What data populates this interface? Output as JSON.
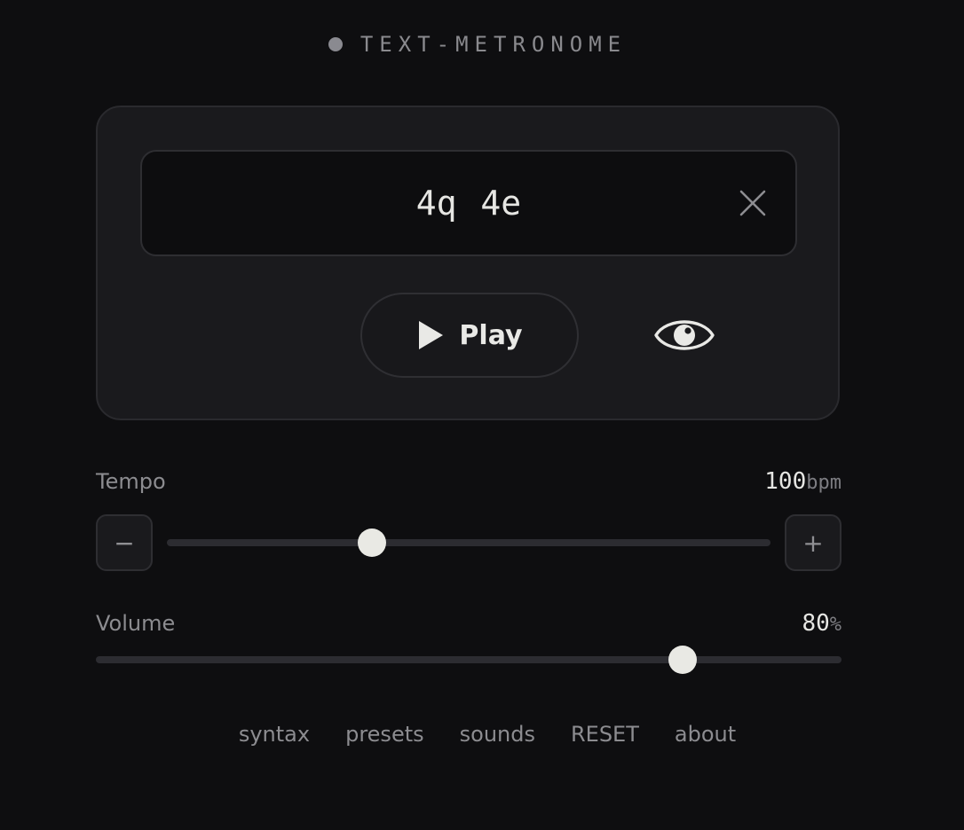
{
  "app": {
    "title": "TEXT-METRONOME"
  },
  "pattern": {
    "value": "4q 4e"
  },
  "controls": {
    "play_label": "Play"
  },
  "tempo": {
    "label": "Tempo",
    "value": "100",
    "unit": "bpm",
    "decrement_label": "−",
    "increment_label": "+",
    "slider_fraction": 0.34
  },
  "volume": {
    "label": "Volume",
    "value": "80",
    "unit": "%",
    "slider_fraction": 0.787
  },
  "footer": {
    "links": [
      "syntax",
      "presets",
      "sounds",
      "RESET",
      "about"
    ]
  },
  "colors": {
    "background": "#0e0e10",
    "card": "#1a1a1d",
    "accent_light": "#e9e9e4",
    "muted_text": "#8c8c90"
  },
  "icons": {
    "brand": "status-dot-icon",
    "clear": "close-icon",
    "play": "play-icon",
    "visibility": "eye-icon"
  }
}
